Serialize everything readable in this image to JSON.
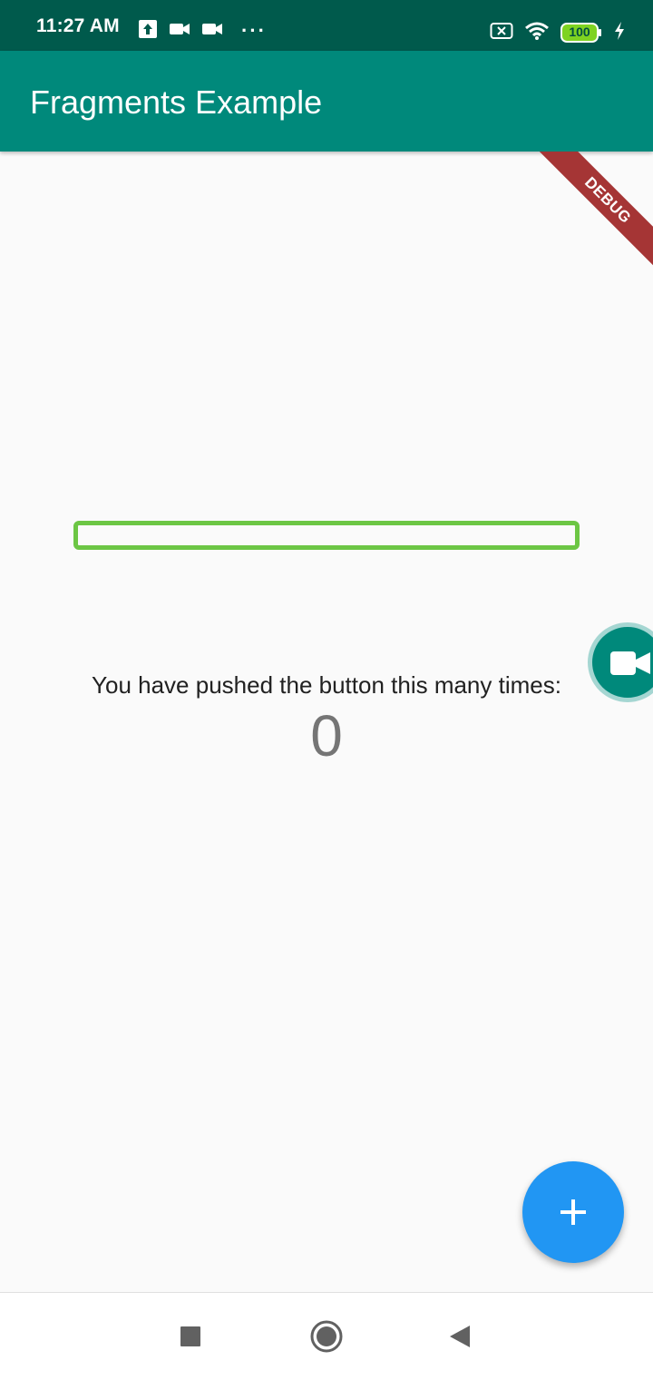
{
  "status_bar": {
    "time": "11:27 AM",
    "more": "···",
    "battery": "100",
    "icons": [
      "upload-icon",
      "video-camera-icon",
      "video-camera-icon",
      "more-icon",
      "no-sim-icon",
      "wifi-icon",
      "battery-icon",
      "charging-icon"
    ]
  },
  "app_bar": {
    "title": "Fragments Example"
  },
  "debug_banner": {
    "label": "DEBUG"
  },
  "main": {
    "progress": {
      "value": 0
    },
    "push_text": "You have pushed the button this many times:",
    "counter": "0"
  },
  "fab": {
    "icon": "plus-icon"
  },
  "floating_bubble": {
    "icon": "video-camera-icon"
  },
  "nav_bar": {
    "items": [
      "recents-icon",
      "home-icon",
      "back-icon"
    ]
  },
  "colors": {
    "status_bar": "#005a4c",
    "app_bar": "#00897b",
    "fab": "#2196f3",
    "outline_bar": "#6cc644",
    "debug": "#a53535"
  }
}
